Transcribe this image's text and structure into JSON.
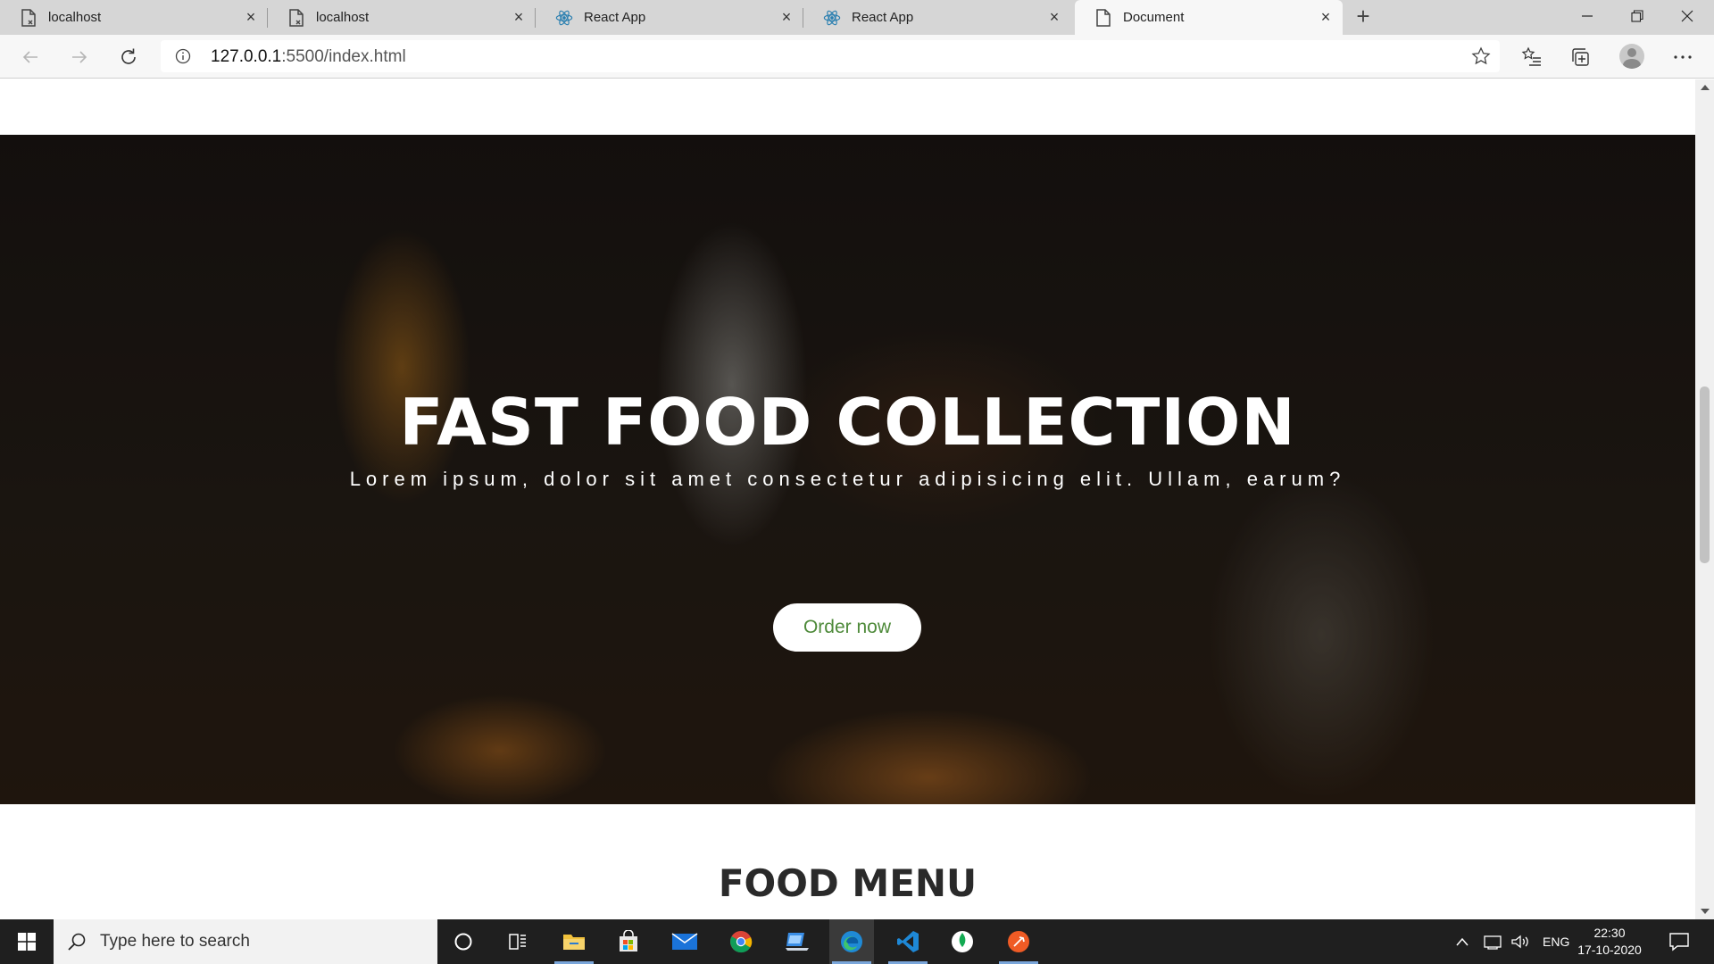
{
  "browser": {
    "tabs": [
      {
        "title": "localhost",
        "icon": "page-error-icon",
        "active": false
      },
      {
        "title": "localhost",
        "icon": "page-error-icon",
        "active": false
      },
      {
        "title": "React App",
        "icon": "react-icon",
        "active": false
      },
      {
        "title": "React App",
        "icon": "react-icon",
        "active": false
      },
      {
        "title": "Document",
        "icon": "page-icon",
        "active": true
      }
    ],
    "new_tab_label": "+",
    "address": {
      "host": "127.0.0.1",
      "rest": ":5500/index.html"
    }
  },
  "page": {
    "hero": {
      "title": "FAST FOOD COLLECTION",
      "subtitle": "Lorem ipsum, dolor sit amet consectetur adipisicing elit. Ullam, earum?",
      "button": "Order now"
    },
    "section_title": "FOOD MENU"
  },
  "taskbar": {
    "search_placeholder": "Type here to search",
    "apps": [
      "cortana-icon",
      "task-view-icon",
      "file-explorer-icon",
      "store-icon",
      "mail-icon",
      "chrome-icon",
      "laptop-icon",
      "edge-icon",
      "vscode-icon",
      "mongodb-icon",
      "postman-icon"
    ],
    "language": "ENG",
    "time": "22:30",
    "date": "17-10-2020"
  },
  "colors": {
    "accent_green": "#4e8a3a",
    "taskbar": "#1f1f1f",
    "tabstrip": "#d6d6d6"
  }
}
